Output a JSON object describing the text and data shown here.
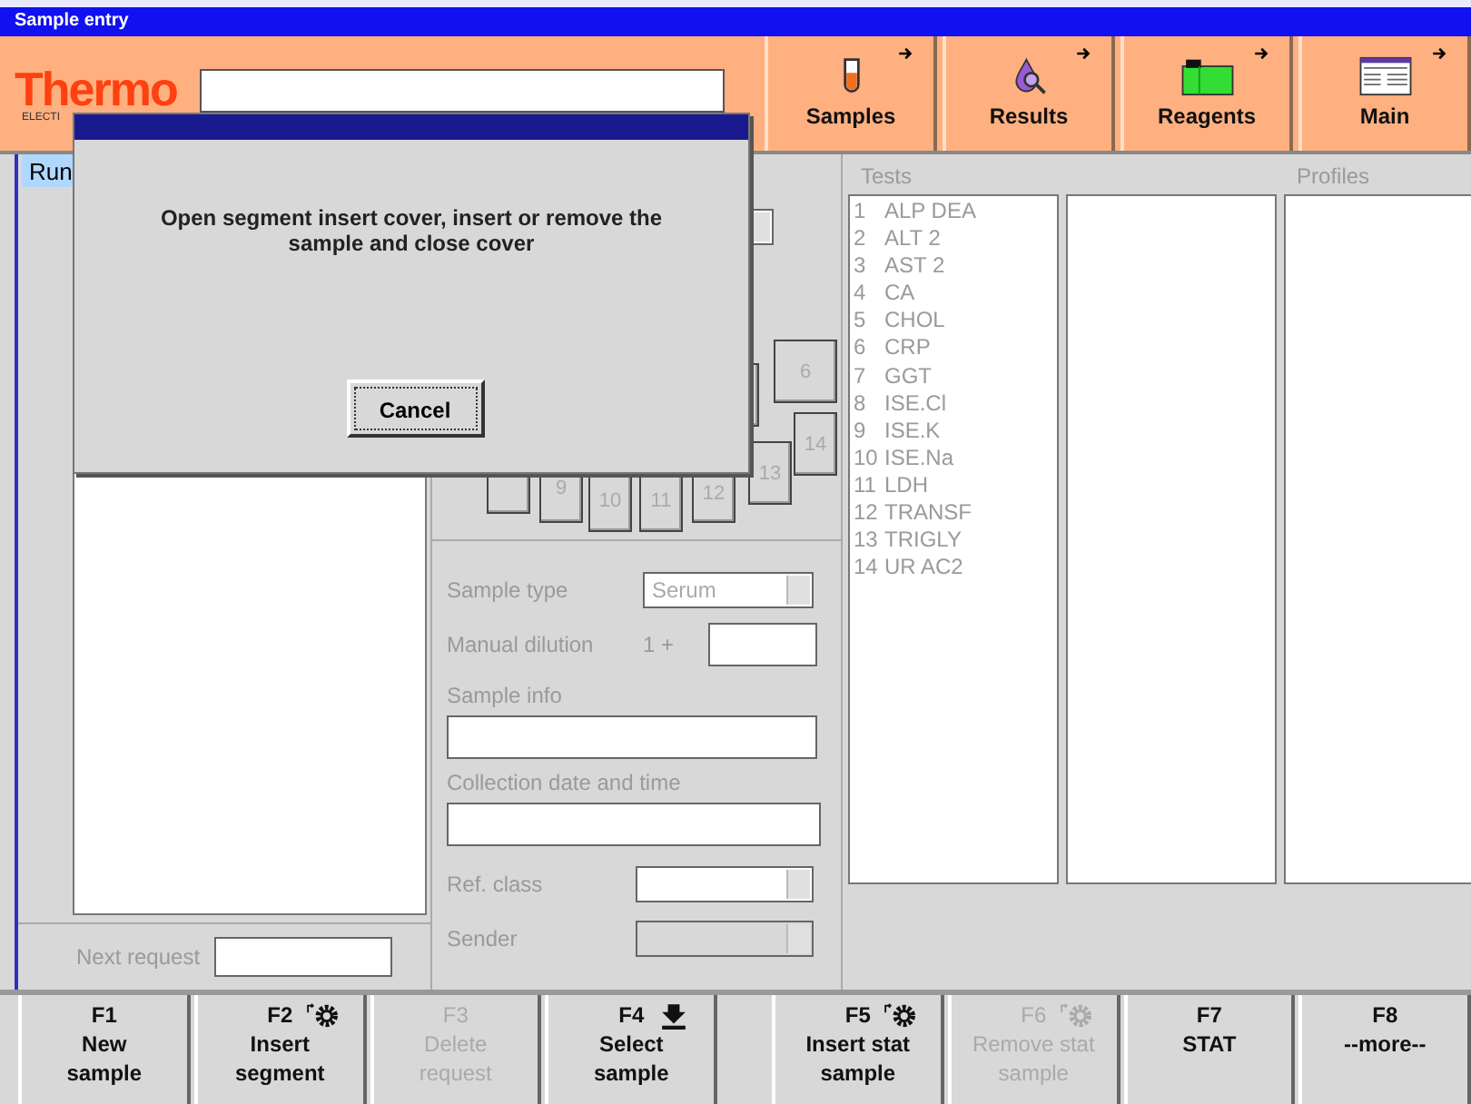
{
  "window": {
    "title": "Sample entry"
  },
  "header": {
    "logo": "Thermo",
    "logo_subtitle": "ELECTI",
    "nav": [
      {
        "label": "Samples"
      },
      {
        "label": "Results"
      },
      {
        "label": "Reagents"
      },
      {
        "label": "Main"
      }
    ]
  },
  "left_panel": {
    "column_header": "Run",
    "next_request_label": "Next request"
  },
  "segment_slots": [
    {
      "kind": "blank"
    },
    {
      "kind": "numbered",
      "label": "9"
    },
    {
      "kind": "numbered",
      "label": "10"
    },
    {
      "kind": "numbered",
      "label": "11"
    },
    {
      "kind": "numbered",
      "label": "12"
    },
    {
      "kind": "numbered",
      "label": "13"
    },
    {
      "kind": "blank"
    },
    {
      "kind": "numbered",
      "label": "6"
    },
    {
      "kind": "numbered",
      "label": "14"
    }
  ],
  "form": {
    "sample_type": {
      "label": "Sample type",
      "value": "Serum"
    },
    "manual_dilution": {
      "label": "Manual dilution",
      "prefix": "1 +"
    },
    "sample_info": {
      "label": "Sample info"
    },
    "collection": {
      "label": "Collection date and time"
    },
    "ref_class": {
      "label": "Ref. class",
      "disabled": false
    },
    "sender": {
      "label": "Sender",
      "disabled": true
    }
  },
  "tests": {
    "header": "Tests",
    "items": [
      {
        "number": "1",
        "name": "ALP DEA"
      },
      {
        "number": "2",
        "name": "ALT 2"
      },
      {
        "number": "3",
        "name": "AST 2"
      },
      {
        "number": "4",
        "name": "CA"
      },
      {
        "number": "5",
        "name": "CHOL"
      },
      {
        "number": "6",
        "name": "CRP"
      },
      {
        "number": "7",
        "name": "GGT"
      },
      {
        "number": "8",
        "name": "ISE.Cl"
      },
      {
        "number": "9",
        "name": "ISE.K"
      },
      {
        "number": "10",
        "name": "ISE.Na"
      },
      {
        "number": "11",
        "name": "LDH"
      },
      {
        "number": "12",
        "name": "TRANSF"
      },
      {
        "number": "13",
        "name": "TRIGLY"
      },
      {
        "number": "14",
        "name": "UR AC2"
      }
    ]
  },
  "profiles": {
    "header": "Profiles"
  },
  "dialog": {
    "message": "Open segment insert cover, insert or remove the sample and close cover",
    "buttons": [
      "Cancel"
    ]
  },
  "function_keys": [
    {
      "key": "F1",
      "lines": [
        "New",
        "sample"
      ],
      "kind": "plain",
      "disabled": false
    },
    {
      "key": "F2",
      "lines": [
        "Insert",
        "segment"
      ],
      "kind": "gear",
      "disabled": false
    },
    {
      "key": "F3",
      "lines": [
        "Delete",
        "request"
      ],
      "kind": "plain",
      "disabled": true
    },
    {
      "key": "F4",
      "lines": [
        "Select",
        "sample"
      ],
      "kind": "download",
      "disabled": false
    },
    {
      "key": "F5",
      "lines": [
        "Insert stat",
        "sample"
      ],
      "kind": "gear",
      "disabled": false
    },
    {
      "key": "F6",
      "lines": [
        "Remove stat",
        "sample"
      ],
      "kind": "gear",
      "disabled": true
    },
    {
      "key": "F7",
      "lines": [
        "STAT"
      ],
      "kind": "plain",
      "disabled": false
    },
    {
      "key": "F8",
      "lines": [
        "--more--"
      ],
      "kind": "plain",
      "disabled": false
    }
  ]
}
